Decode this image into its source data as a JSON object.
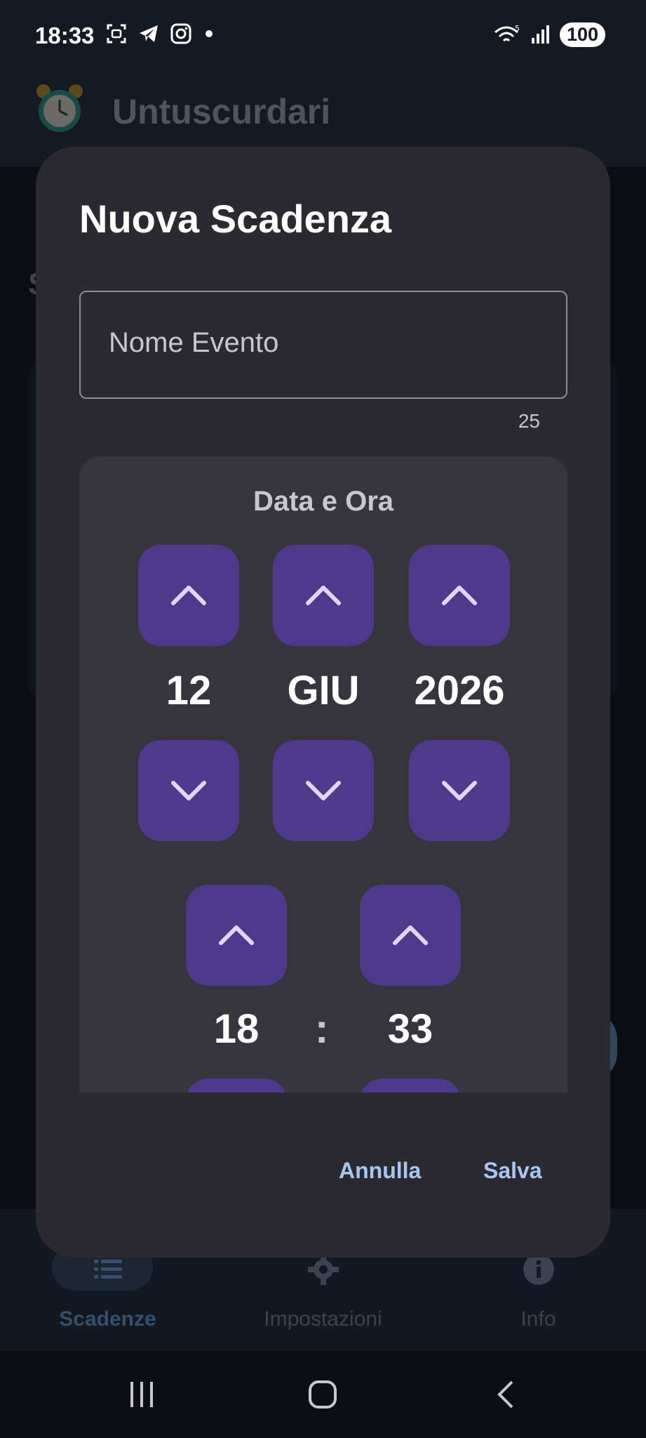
{
  "status_bar": {
    "time": "18:33",
    "battery": "100",
    "icons_left": [
      "screenshot-icon",
      "telegram-icon",
      "instagram-icon",
      "dot-icon"
    ],
    "icons_right": [
      "wifi-icon",
      "signal-icon",
      "battery-icon"
    ]
  },
  "app_bar": {
    "title": "Untuscurdari",
    "logo_icon": "alarm-clock-icon"
  },
  "dialog": {
    "title": "Nuova Scadenza",
    "name_field": {
      "placeholder": "Nome Evento",
      "value": "",
      "counter": "25"
    },
    "date_time": {
      "label": "Data e Ora",
      "day": "12",
      "month": "GIU",
      "year": "2026",
      "hour": "18",
      "separator": ":",
      "minute": "33"
    },
    "actions": {
      "cancel": "Annulla",
      "save": "Salva"
    }
  },
  "bottom_nav": {
    "items": [
      {
        "label": "Scadenze",
        "icon": "list-icon",
        "active": true
      },
      {
        "label": "Impostazioni",
        "icon": "gear-icon",
        "active": false
      },
      {
        "label": "Info",
        "icon": "info-icon",
        "active": false
      }
    ]
  },
  "colors": {
    "dialog_bg": "#2b2a30",
    "panel_bg": "#36353d",
    "spinner_bg": "#4f398b",
    "chevron": "#e3d4ff",
    "action_text": "#a8c7f0"
  }
}
